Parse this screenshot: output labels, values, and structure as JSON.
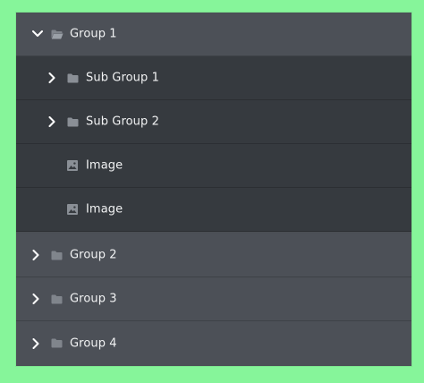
{
  "tree": {
    "group1": {
      "label": "Group 1",
      "expanded": true,
      "icon": "folder-open-icon"
    },
    "children": [
      {
        "label": "Sub Group 1",
        "type": "folder",
        "icon": "folder-icon"
      },
      {
        "label": "Sub Group 2",
        "type": "folder",
        "icon": "folder-icon"
      },
      {
        "label": "Image",
        "type": "image",
        "icon": "image-icon"
      },
      {
        "label": "Image",
        "type": "image",
        "icon": "image-icon"
      }
    ],
    "groups": [
      {
        "label": "Group 2",
        "expanded": false,
        "icon": "folder-icon"
      },
      {
        "label": "Group 3",
        "expanded": false,
        "icon": "folder-icon"
      },
      {
        "label": "Group 4",
        "expanded": false,
        "icon": "folder-icon"
      }
    ]
  },
  "colors": {
    "background": "#86f59a",
    "row": "#4c5057",
    "subrow": "#363a3f",
    "text": "#f1f2f3",
    "icon": "#8a8f96"
  }
}
